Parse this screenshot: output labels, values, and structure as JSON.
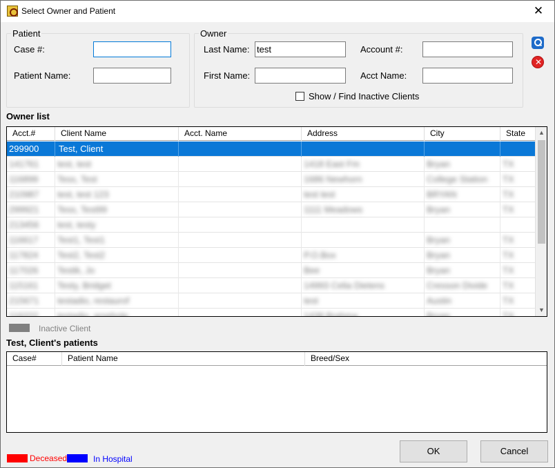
{
  "window": {
    "title": "Select Owner and Patient",
    "close_glyph": "✕",
    "icon": "app-logo-icon"
  },
  "patient_group": {
    "legend": "Patient",
    "case_label": "Case #:",
    "case_value": "",
    "patient_name_label": "Patient Name:",
    "patient_name_value": ""
  },
  "owner_group": {
    "legend": "Owner",
    "last_name_label": "Last Name:",
    "last_name_value": "test",
    "first_name_label": "First Name:",
    "first_name_value": "",
    "account_label": "Account #:",
    "account_value": "",
    "acct_name_label": "Acct Name:",
    "acct_name_value": "",
    "inactive_checkbox_label": "Show / Find Inactive Clients",
    "inactive_checked": false
  },
  "side_buttons": {
    "search_icon": "search-icon",
    "clear_icon": "clear-icon",
    "clear_glyph": "✕"
  },
  "owner_list": {
    "title": "Owner list",
    "columns": [
      "Acct.#",
      "Client Name",
      "Acct. Name",
      "Address",
      "City",
      "State"
    ],
    "selected_row": [
      "299900",
      "Test, Client",
      "",
      "",
      "",
      ""
    ],
    "rows": [
      [
        "141761",
        "test, test",
        "",
        "1418 East Fm",
        "Bryan",
        "TX"
      ],
      [
        "116899",
        "Tess, Test",
        "",
        "1686 Newhorn",
        "College Station",
        "TX"
      ],
      [
        "210987",
        "test, test 123",
        "",
        "test test",
        "BRYAN",
        "TX"
      ],
      [
        "299921",
        "Tess, Test99",
        "",
        "1111 Meadows",
        "Bryan",
        "TX"
      ],
      [
        "213456",
        "test, testy",
        "",
        "",
        "",
        ""
      ],
      [
        "116617",
        "Test1, Test1",
        "",
        "",
        "Bryan",
        "TX"
      ],
      [
        "117824",
        "Test2, Test2",
        "",
        "P.O.Box",
        "Bryan",
        "TX"
      ],
      [
        "117026",
        "Testik, Jo",
        "",
        "Bee",
        "Bryan",
        "TX"
      ],
      [
        "115161",
        "Testy, Bridget",
        "",
        "14993 Celia Dietens",
        "Cresson Divide",
        "TX"
      ],
      [
        "215671",
        "testadio, restaurof",
        "",
        "test",
        "Austin",
        "TX"
      ],
      [
        "116222",
        "testadio, arsehole",
        "",
        "1438 Brahma",
        "Bryan",
        "TX"
      ]
    ],
    "inactive_legend_label": "Inactive Client",
    "inactive_color": "#808080"
  },
  "patients_list": {
    "title": "Test, Client's patients",
    "columns": [
      "Case#",
      "Patient Name",
      "Breed/Sex"
    ],
    "rows": []
  },
  "footer": {
    "deceased_label": "Deceased",
    "deceased_color": "#ff0000",
    "hospital_label": "In Hospital",
    "hospital_color": "#0000ff",
    "ok_label": "OK",
    "cancel_label": "Cancel"
  },
  "accent_color": "#0a78d7"
}
